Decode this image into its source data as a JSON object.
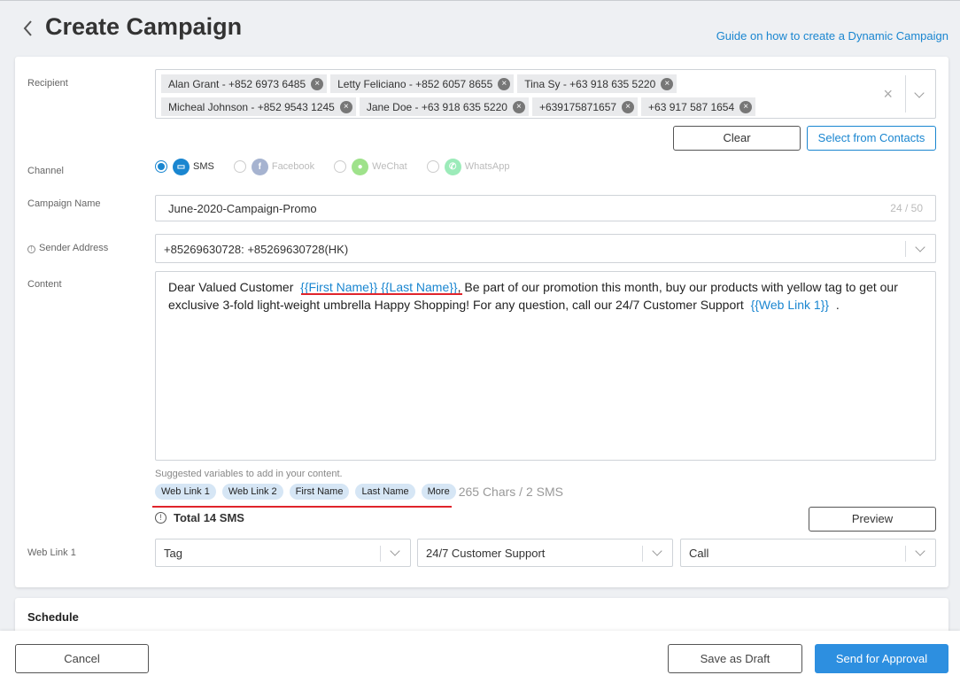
{
  "header": {
    "title": "Create Campaign",
    "guide_link": "Guide on how to create a Dynamic Campaign"
  },
  "form": {
    "recipient": {
      "label": "Recipient",
      "tags": [
        "Alan Grant - +852 6973 6485",
        "Letty Feliciano - +852 6057 8655",
        "Tina Sy - +63 918 635 5220",
        "Micheal Johnson - +852 9543 1245",
        "Jane Doe - +63 918 635 5220",
        "+639175871657",
        "+63 917 587 1654"
      ],
      "clear_button": "Clear",
      "select_button": "Select from Contacts"
    },
    "channel": {
      "label": "Channel",
      "options": [
        {
          "label": "SMS",
          "selected": true,
          "color": "#1a86d0"
        },
        {
          "label": "Facebook",
          "selected": false,
          "color": "#3b5998"
        },
        {
          "label": "WeChat",
          "selected": false,
          "color": "#2dc100"
        },
        {
          "label": "WhatsApp",
          "selected": false,
          "color": "#25d366"
        }
      ]
    },
    "campaign_name": {
      "label": "Campaign Name",
      "value": "June-2020-Campaign-Promo",
      "counter": "24 / 50"
    },
    "sender_address": {
      "label": "Sender Address",
      "value": "+85269630728: +85269630728(HK)"
    },
    "content": {
      "label": "Content",
      "part1": "Dear Valued Customer",
      "var_first": "{{First Name}}",
      "var_last": "{{Last Name}}",
      "part2": ", Be part of our promotion this month, buy our products with yellow tag to get our exclusive 3-fold light-weight umbrella  Happy Shopping! For any question, call our 24/7 Customer Support",
      "var_link": "{{Web Link 1}}",
      "part3": "."
    },
    "suggested": {
      "label": "Suggested variables to add in your content.",
      "chips": [
        "Web Link 1",
        "Web Link 2",
        "First Name",
        "Last Name",
        "More"
      ],
      "chars": "265 Chars / 2 SMS"
    },
    "total": "Total 14 SMS",
    "preview_button": "Preview",
    "web_link": {
      "label": "Web Link 1",
      "select1": "Tag",
      "select2": "24/7 Customer Support",
      "select3": "Call"
    }
  },
  "schedule": {
    "title": "Schedule"
  },
  "footer": {
    "cancel": "Cancel",
    "save_draft": "Save as Draft",
    "send": "Send for Approval"
  }
}
